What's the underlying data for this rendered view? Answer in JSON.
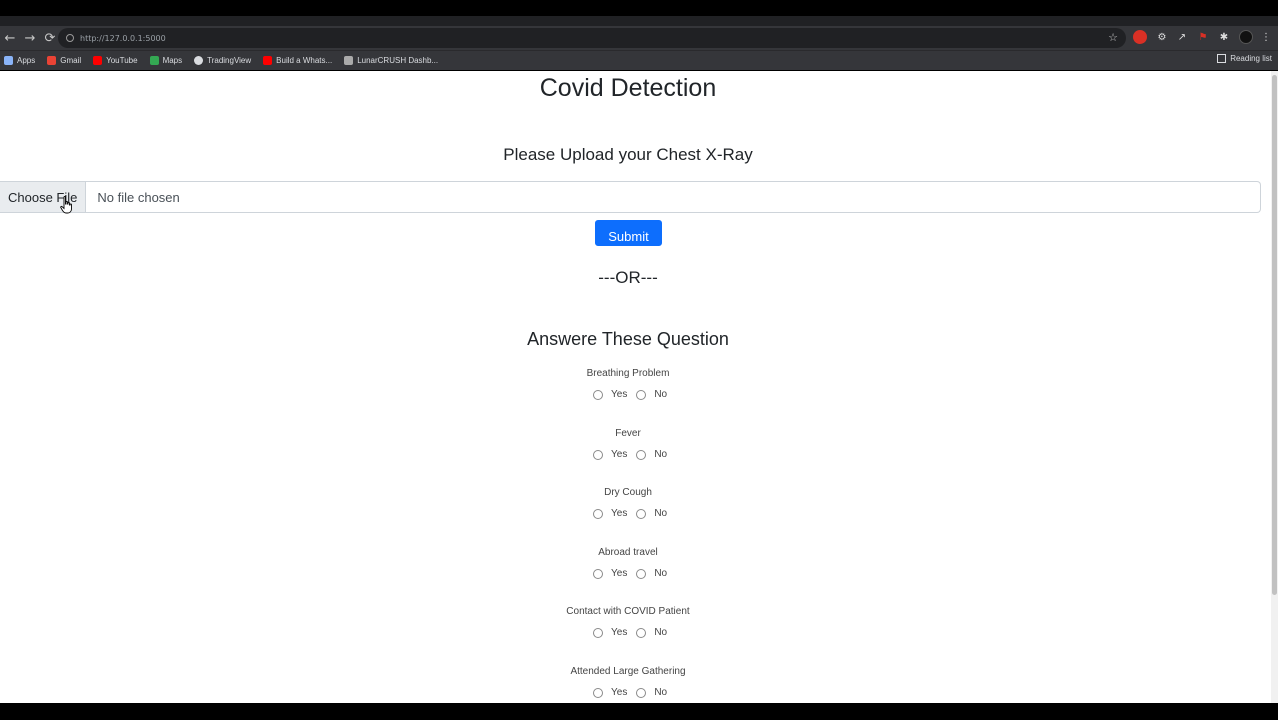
{
  "browser": {
    "url": "http://127.0.0.1:5000",
    "bookmarks": [
      "Apps",
      "Gmail",
      "YouTube",
      "Maps",
      "TradingView",
      "Build a Whats...",
      "LunarCRUSH Dashb..."
    ],
    "reading_list": "Reading list"
  },
  "page": {
    "title": "Covid Detection",
    "upload_heading": "Please Upload your Chest X-Ray",
    "choose_file": "Choose File",
    "no_file": "No file chosen",
    "submit": "Submit",
    "or": "---OR---",
    "questions_heading": "Answere These Question",
    "questions": [
      {
        "label": "Breathing Problem",
        "yes": "Yes",
        "no": "No"
      },
      {
        "label": "Fever",
        "yes": "Yes",
        "no": "No"
      },
      {
        "label": "Dry Cough",
        "yes": "Yes",
        "no": "No"
      },
      {
        "label": "Abroad travel",
        "yes": "Yes",
        "no": "No"
      },
      {
        "label": "Contact with COVID Patient",
        "yes": "Yes",
        "no": "No"
      },
      {
        "label": "Attended Large Gathering",
        "yes": "Yes",
        "no": "No"
      }
    ]
  }
}
